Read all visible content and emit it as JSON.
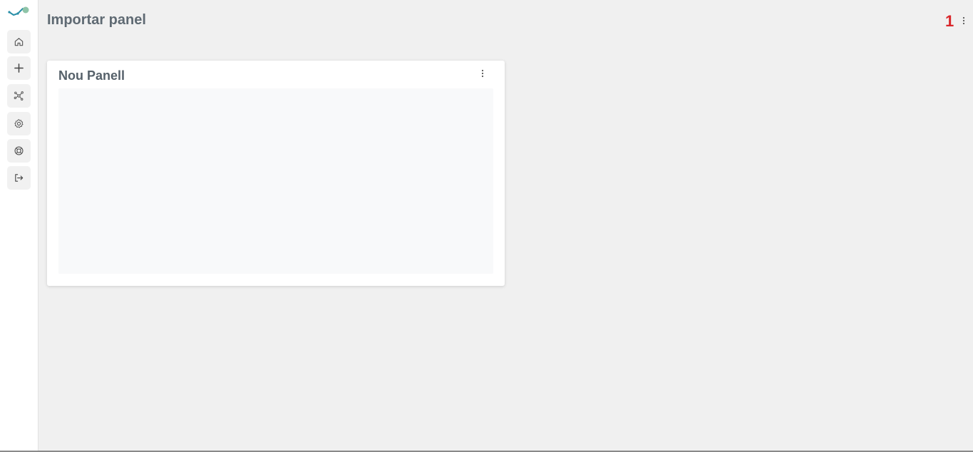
{
  "header": {
    "title": "Importar panel",
    "badge": "1"
  },
  "sidebar": {
    "items": [
      {
        "name": "home",
        "icon": "home-icon"
      },
      {
        "name": "add",
        "icon": "plus-icon"
      },
      {
        "name": "network",
        "icon": "network-icon"
      },
      {
        "name": "settings",
        "icon": "gear-icon"
      },
      {
        "name": "help",
        "icon": "lifebuoy-icon"
      },
      {
        "name": "logout",
        "icon": "logout-icon"
      }
    ]
  },
  "panels": [
    {
      "title": "Nou Panell"
    }
  ],
  "colors": {
    "accent_teal": "#2a8fa8",
    "accent_green": "#8fc4a8",
    "badge_red": "#d9262a",
    "text_gray": "#5f6a73"
  }
}
